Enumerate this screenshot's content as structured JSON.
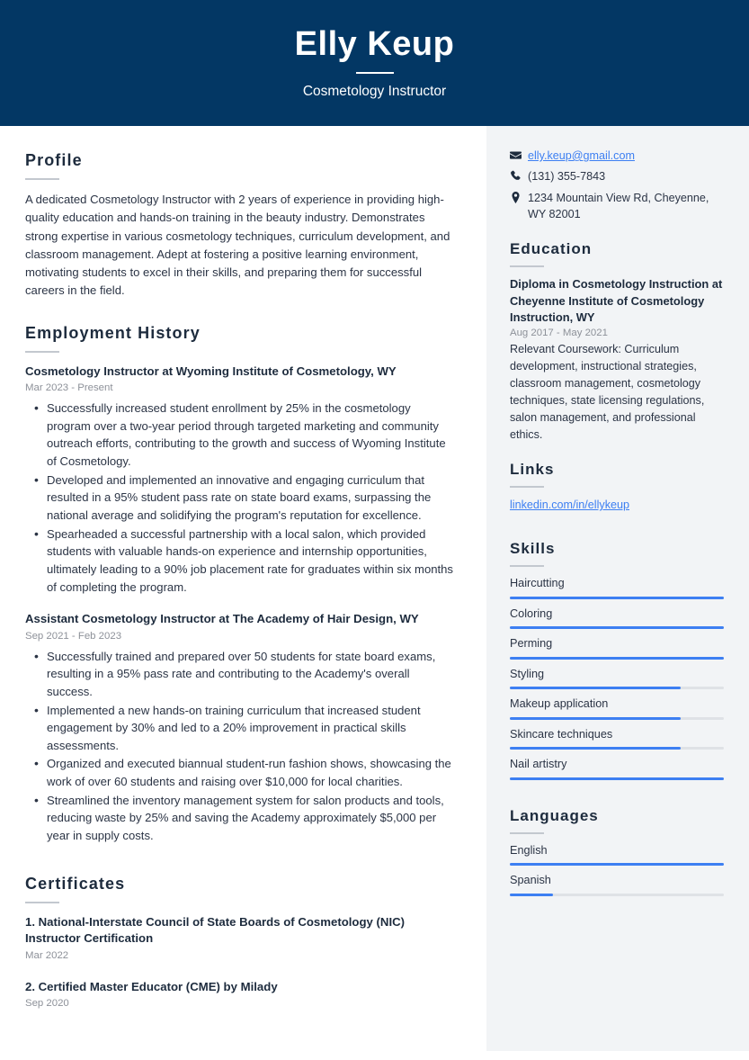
{
  "theme": {
    "header_bg": "#033764",
    "sidebar_bg": "#f2f4f6",
    "accent": "#3d7ff2",
    "text": "#2b3445",
    "muted": "#8d9199"
  },
  "header": {
    "name": "Elly Keup",
    "title": "Cosmetology Instructor"
  },
  "profile": {
    "heading": "Profile",
    "text": "A dedicated Cosmetology Instructor with 2 years of experience in providing high-quality education and hands-on training in the beauty industry. Demonstrates strong expertise in various cosmetology techniques, curriculum development, and classroom management. Adept at fostering a positive learning environment, motivating students to excel in their skills, and preparing them for successful careers in the field."
  },
  "employment": {
    "heading": "Employment History",
    "jobs": [
      {
        "title": "Cosmetology Instructor at Wyoming Institute of Cosmetology, WY",
        "date": "Mar 2023 - Present",
        "bullets": [
          "Successfully increased student enrollment by 25% in the cosmetology program over a two-year period through targeted marketing and community outreach efforts, contributing to the growth and success of Wyoming Institute of Cosmetology.",
          "Developed and implemented an innovative and engaging curriculum that resulted in a 95% student pass rate on state board exams, surpassing the national average and solidifying the program's reputation for excellence.",
          "Spearheaded a successful partnership with a local salon, which provided students with valuable hands-on experience and internship opportunities, ultimately leading to a 90% job placement rate for graduates within six months of completing the program."
        ]
      },
      {
        "title": "Assistant Cosmetology Instructor at The Academy of Hair Design, WY",
        "date": "Sep 2021 - Feb 2023",
        "bullets": [
          "Successfully trained and prepared over 50 students for state board exams, resulting in a 95% pass rate and contributing to the Academy's overall success.",
          "Implemented a new hands-on training curriculum that increased student engagement by 30% and led to a 20% improvement in practical skills assessments.",
          "Organized and executed biannual student-run fashion shows, showcasing the work of over 60 students and raising over $10,000 for local charities.",
          "Streamlined the inventory management system for salon products and tools, reducing waste by 25% and saving the Academy approximately $5,000 per year in supply costs."
        ]
      }
    ]
  },
  "certificates": {
    "heading": "Certificates",
    "items": [
      {
        "title": "1. National-Interstate Council of State Boards of Cosmetology (NIC) Instructor Certification",
        "date": "Mar 2022"
      },
      {
        "title": "2. Certified Master Educator (CME) by Milady",
        "date": "Sep 2020"
      }
    ]
  },
  "contact": {
    "email": "elly.keup@gmail.com",
    "phone": "(131) 355-7843",
    "address": "1234 Mountain View Rd, Cheyenne, WY 82001",
    "icons": {
      "email": "envelope-icon",
      "phone": "phone-icon",
      "address": "location-pin-icon"
    }
  },
  "education": {
    "heading": "Education",
    "items": [
      {
        "title": "Diploma in Cosmetology Instruction at Cheyenne Institute of Cosmetology Instruction, WY",
        "date": "Aug 2017 - May 2021",
        "body": "Relevant Coursework: Curriculum development, instructional strategies, classroom management, cosmetology techniques, state licensing regulations, salon management, and professional ethics."
      }
    ]
  },
  "links": {
    "heading": "Links",
    "items": [
      {
        "label": "linkedin.com/in/ellykeup"
      }
    ]
  },
  "skills": {
    "heading": "Skills",
    "items": [
      {
        "label": "Haircutting",
        "level": 100
      },
      {
        "label": "Coloring",
        "level": 100
      },
      {
        "label": "Perming",
        "level": 100
      },
      {
        "label": "Styling",
        "level": 80
      },
      {
        "label": "Makeup application",
        "level": 80
      },
      {
        "label": "Skincare techniques",
        "level": 80
      },
      {
        "label": "Nail artistry",
        "level": 100
      }
    ]
  },
  "languages": {
    "heading": "Languages",
    "items": [
      {
        "label": "English",
        "level": 100
      },
      {
        "label": "Spanish",
        "level": 20
      }
    ]
  }
}
